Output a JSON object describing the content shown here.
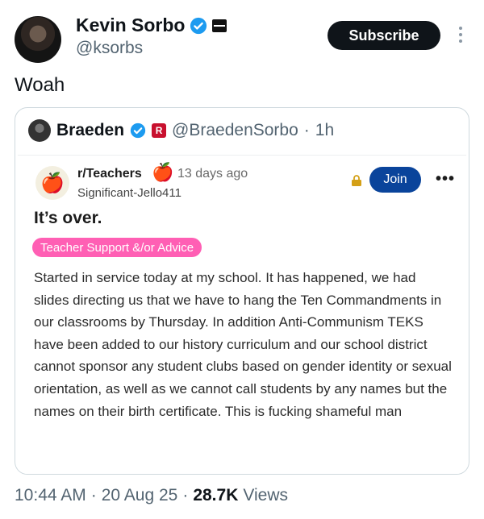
{
  "author": {
    "name": "Kevin Sorbo",
    "handle": "@ksorbs"
  },
  "actions": {
    "subscribe_label": "Subscribe"
  },
  "tweet": {
    "text": "Woah"
  },
  "quote": {
    "author_name": "Braeden",
    "handle": "@BraedenSorbo",
    "separator": "·",
    "time": "1h",
    "reddit": {
      "subreddit": "r/Teachers",
      "age": "13 days ago",
      "username": "Significant-Jello411",
      "join_label": "Join",
      "more_label": "•••",
      "title": "It’s over.",
      "flair": "Teacher Support &/or Advice",
      "body": "Started in service today at my school. It has happened, we had slides directing us that we have to hang the Ten Commandments in our classrooms by Thursday. In addition Anti-Communism TEKS have been added to our history curriculum and our school district cannot sponsor any student clubs based on gender identity or sexual orientation, as well as we cannot call students by any names but the names on their birth certificate. This is fucking shameful man"
    }
  },
  "meta": {
    "time": "10:44 AM",
    "sep1": "·",
    "date": "20 Aug 25",
    "sep2": "·",
    "views_count": "28.7K",
    "views_label": "Views"
  },
  "colors": {
    "verified": "#1d9bf0",
    "join": "#0a449b",
    "flair": "#ff5fb4",
    "subscribe": "#0f1419"
  },
  "icons": [
    "verified-badge-icon",
    "flag-icon",
    "more-icon",
    "apple-icon",
    "lock-icon"
  ]
}
